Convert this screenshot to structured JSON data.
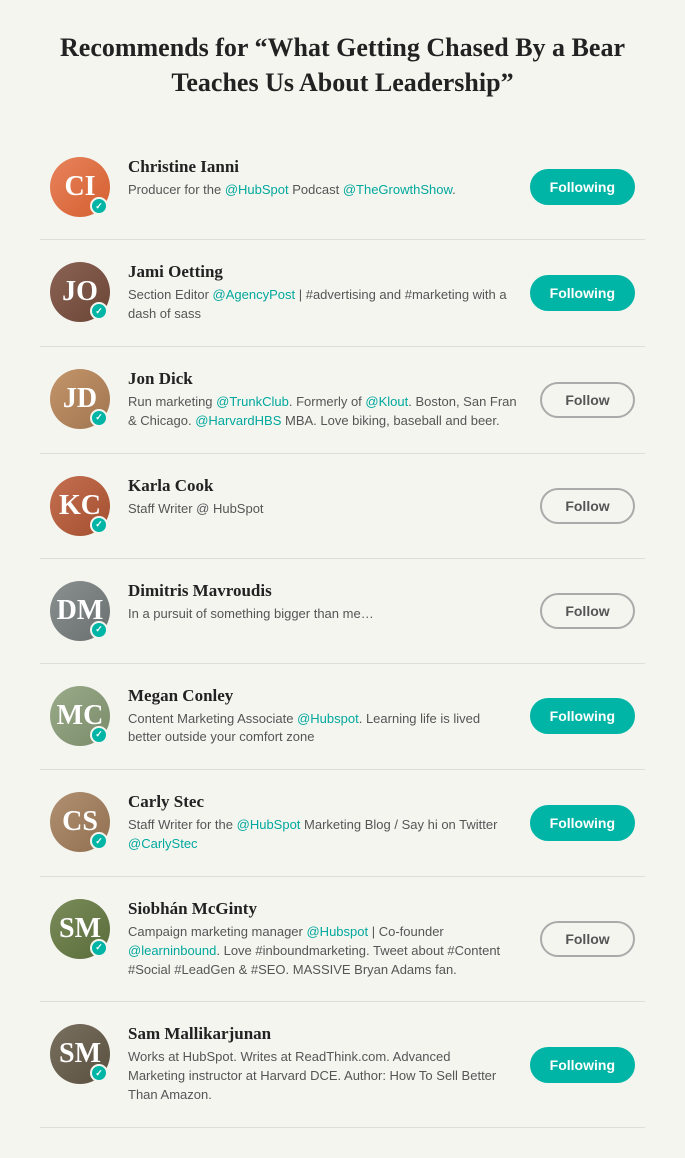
{
  "page": {
    "title": "Recommends for “What Getting Chased By a Bear Teaches Us About Leadership”"
  },
  "users": [
    {
      "id": 1,
      "name": "Christine Ianni",
      "bio_parts": [
        {
          "text": "Producer for the ",
          "type": "normal"
        },
        {
          "text": "@HubSpot",
          "type": "mention"
        },
        {
          "text": " Podcast ",
          "type": "normal"
        },
        {
          "text": "@TheGrowthShow",
          "type": "mention"
        },
        {
          "text": ".",
          "type": "normal"
        }
      ],
      "bio_plain": "Producer for the @HubSpot Podcast @TheGrowthShow.",
      "status": "following",
      "avatar_color": "bg-orange",
      "initials": "CI"
    },
    {
      "id": 2,
      "name": "Jami Oetting",
      "bio_parts": [
        {
          "text": "Section Editor ",
          "type": "normal"
        },
        {
          "text": "@AgencyPost",
          "type": "mention"
        },
        {
          "text": " | #advertising and #marketing with a dash of sass",
          "type": "normal"
        }
      ],
      "bio_plain": "Section Editor @AgencyPost | #advertising and #marketing with a dash of sass",
      "status": "following",
      "avatar_color": "bg-brown",
      "initials": "JO"
    },
    {
      "id": 3,
      "name": "Jon Dick",
      "bio_parts": [
        {
          "text": "Run marketing ",
          "type": "normal"
        },
        {
          "text": "@TrunkClub",
          "type": "mention"
        },
        {
          "text": ". Formerly of ",
          "type": "normal"
        },
        {
          "text": "@Klout",
          "type": "mention"
        },
        {
          "text": ". Boston, San Fran & Chicago. ",
          "type": "normal"
        },
        {
          "text": "@HarvardHBS",
          "type": "mention"
        },
        {
          "text": " MBA. Love biking, baseball and beer.",
          "type": "normal"
        }
      ],
      "bio_plain": "Run marketing @TrunkClub. Formerly of @Klout. Boston, San Fran & Chicago. @HarvardHBS MBA. Love biking, baseball and beer.",
      "status": "follow",
      "avatar_color": "bg-tan",
      "initials": "JD"
    },
    {
      "id": 4,
      "name": "Karla Cook",
      "bio_parts": [
        {
          "text": "Staff Writer @ HubSpot",
          "type": "normal"
        }
      ],
      "bio_plain": "Staff Writer @ HubSpot",
      "status": "follow",
      "avatar_color": "bg-rust",
      "initials": "KC"
    },
    {
      "id": 5,
      "name": "Dimitris Mavroudis",
      "bio_parts": [
        {
          "text": "In a pursuit of something bigger than me…",
          "type": "normal"
        }
      ],
      "bio_plain": "In a pursuit of something bigger than me…",
      "status": "follow",
      "avatar_color": "bg-gray",
      "initials": "DM"
    },
    {
      "id": 6,
      "name": "Megan Conley",
      "bio_parts": [
        {
          "text": "Content Marketing Associate ",
          "type": "normal"
        },
        {
          "text": "@Hubspot",
          "type": "mention"
        },
        {
          "text": ". Learning life is lived better outside your comfort zone",
          "type": "normal"
        }
      ],
      "bio_plain": "Content Marketing Associate @Hubspot. Learning life is lived better outside your comfort zone",
      "status": "following",
      "avatar_color": "bg-sage",
      "initials": "MC"
    },
    {
      "id": 7,
      "name": "Carly Stec",
      "bio_parts": [
        {
          "text": "Staff Writer for the ",
          "type": "normal"
        },
        {
          "text": "@HubSpot",
          "type": "mention"
        },
        {
          "text": " Marketing Blog / Say hi on Twitter ",
          "type": "normal"
        },
        {
          "text": "@CarlyStec",
          "type": "mention"
        }
      ],
      "bio_plain": "Staff Writer for the @HubSpot Marketing Blog / Say hi on Twitter @CarlyStec",
      "status": "following",
      "avatar_color": "bg-warm",
      "initials": "CS"
    },
    {
      "id": 8,
      "name": "Siobhán McGinty",
      "bio_parts": [
        {
          "text": "Campaign marketing manager ",
          "type": "normal"
        },
        {
          "text": "@Hubspot",
          "type": "mention"
        },
        {
          "text": " | Co-founder ",
          "type": "normal"
        },
        {
          "text": "@learninbound",
          "type": "mention"
        },
        {
          "text": ". Love #inboundmarketing. Tweet about #Content #Social #LeadGen & #SEO. MASSIVE Bryan Adams fan.",
          "type": "normal"
        }
      ],
      "bio_plain": "Campaign marketing manager @Hubspot | Co-founder @learninbound. Love #inboundmarketing. Tweet about #Content #Social #LeadGen & #SEO. MASSIVE Bryan Adams fan.",
      "status": "follow",
      "avatar_color": "bg-olive",
      "initials": "SM"
    },
    {
      "id": 9,
      "name": "Sam Mallikarjunan",
      "bio_parts": [
        {
          "text": "Works at HubSpot. Writes at ReadThink.com. Advanced Marketing instructor at Harvard DCE. Author: How To Sell Better Than Amazon.",
          "type": "normal"
        }
      ],
      "bio_plain": "Works at HubSpot. Writes at ReadThink.com. Advanced Marketing instructor at Harvard DCE. Author: How To Sell Better Than Amazon.",
      "status": "following",
      "avatar_color": "bg-dark",
      "initials": "SM"
    }
  ],
  "labels": {
    "following": "Following",
    "follow": "Follow"
  }
}
